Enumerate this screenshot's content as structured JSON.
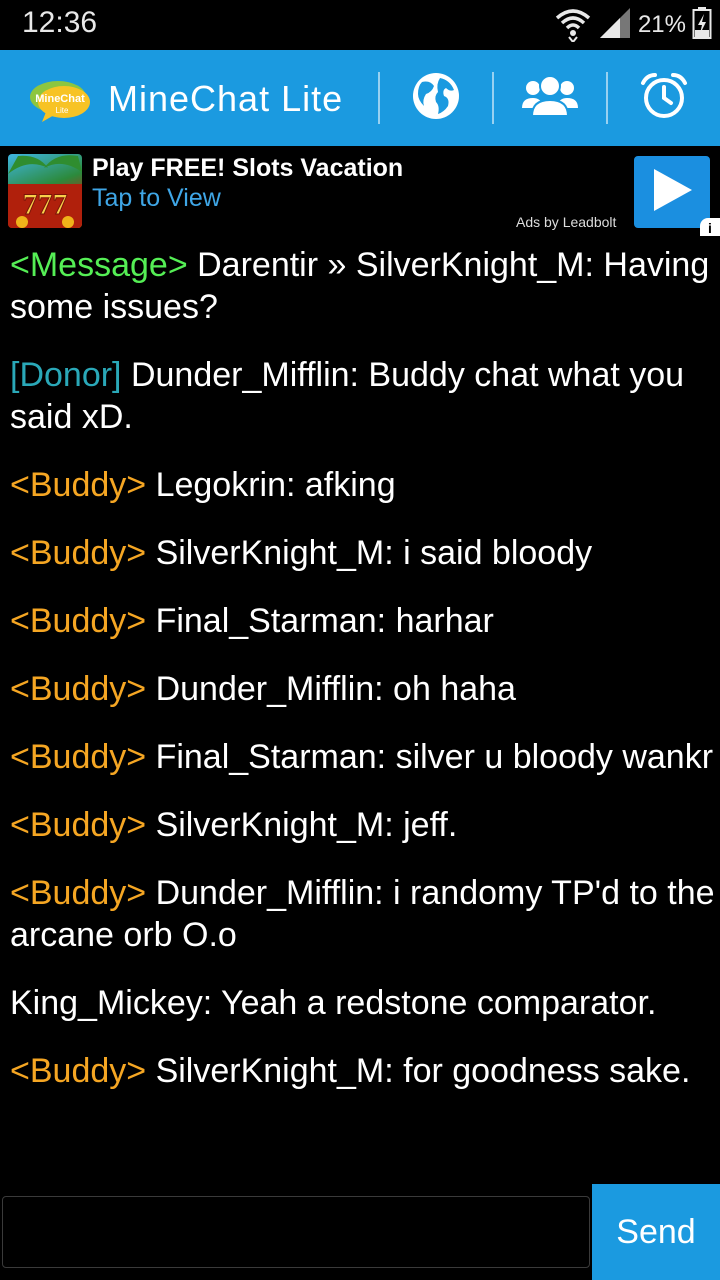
{
  "status_bar": {
    "time": "12:36",
    "battery_percent": "21%",
    "icons": [
      "wifi-icon",
      "signal-icon",
      "battery-icon"
    ]
  },
  "action_bar": {
    "logo_text": "MineChat",
    "logo_subtext": "Lite",
    "title": "MineChat Lite",
    "actions": [
      "globe-icon",
      "buddies-icon",
      "alarm-clock-icon"
    ],
    "color": "#1b9ae0"
  },
  "ad": {
    "title": "Play FREE! Slots Vacation",
    "subtitle": "Tap to View",
    "attribution": "Ads by Leadbolt",
    "info": "i",
    "image_text": "777"
  },
  "colors": {
    "message": "#55ee55",
    "donor": "#2aa8b8",
    "buddy": "#f5a623"
  },
  "messages": [
    {
      "prefix": "<Message>",
      "type": "message",
      "text": " Darentir » SilverKnight_M: Having some issues?"
    },
    {
      "prefix": "[Donor]",
      "type": "donor",
      "text": " Dunder_Mifflin: Buddy chat what you said xD."
    },
    {
      "prefix": "<Buddy>",
      "type": "buddy",
      "text": " Legokrin: afking"
    },
    {
      "prefix": "<Buddy>",
      "type": "buddy",
      "text": " SilverKnight_M: i said bloody"
    },
    {
      "prefix": "<Buddy>",
      "type": "buddy",
      "text": " Final_Starman: harhar"
    },
    {
      "prefix": "<Buddy>",
      "type": "buddy",
      "text": " Dunder_Mifflin: oh haha"
    },
    {
      "prefix": "<Buddy>",
      "type": "buddy",
      "text": " Final_Starman: silver u bloody wankr"
    },
    {
      "prefix": "<Buddy>",
      "type": "buddy",
      "text": " SilverKnight_M: jeff."
    },
    {
      "prefix": "<Buddy>",
      "type": "buddy",
      "text": " Dunder_Mifflin: i randomy TP'd to the arcane orb O.o"
    },
    {
      "prefix": "",
      "type": "plain",
      "text": "King_Mickey: Yeah a redstone comparator."
    },
    {
      "prefix": "<Buddy>",
      "type": "buddy",
      "text": " SilverKnight_M: for goodness sake."
    }
  ],
  "input": {
    "value": "",
    "placeholder": ""
  },
  "send_label": "Send"
}
